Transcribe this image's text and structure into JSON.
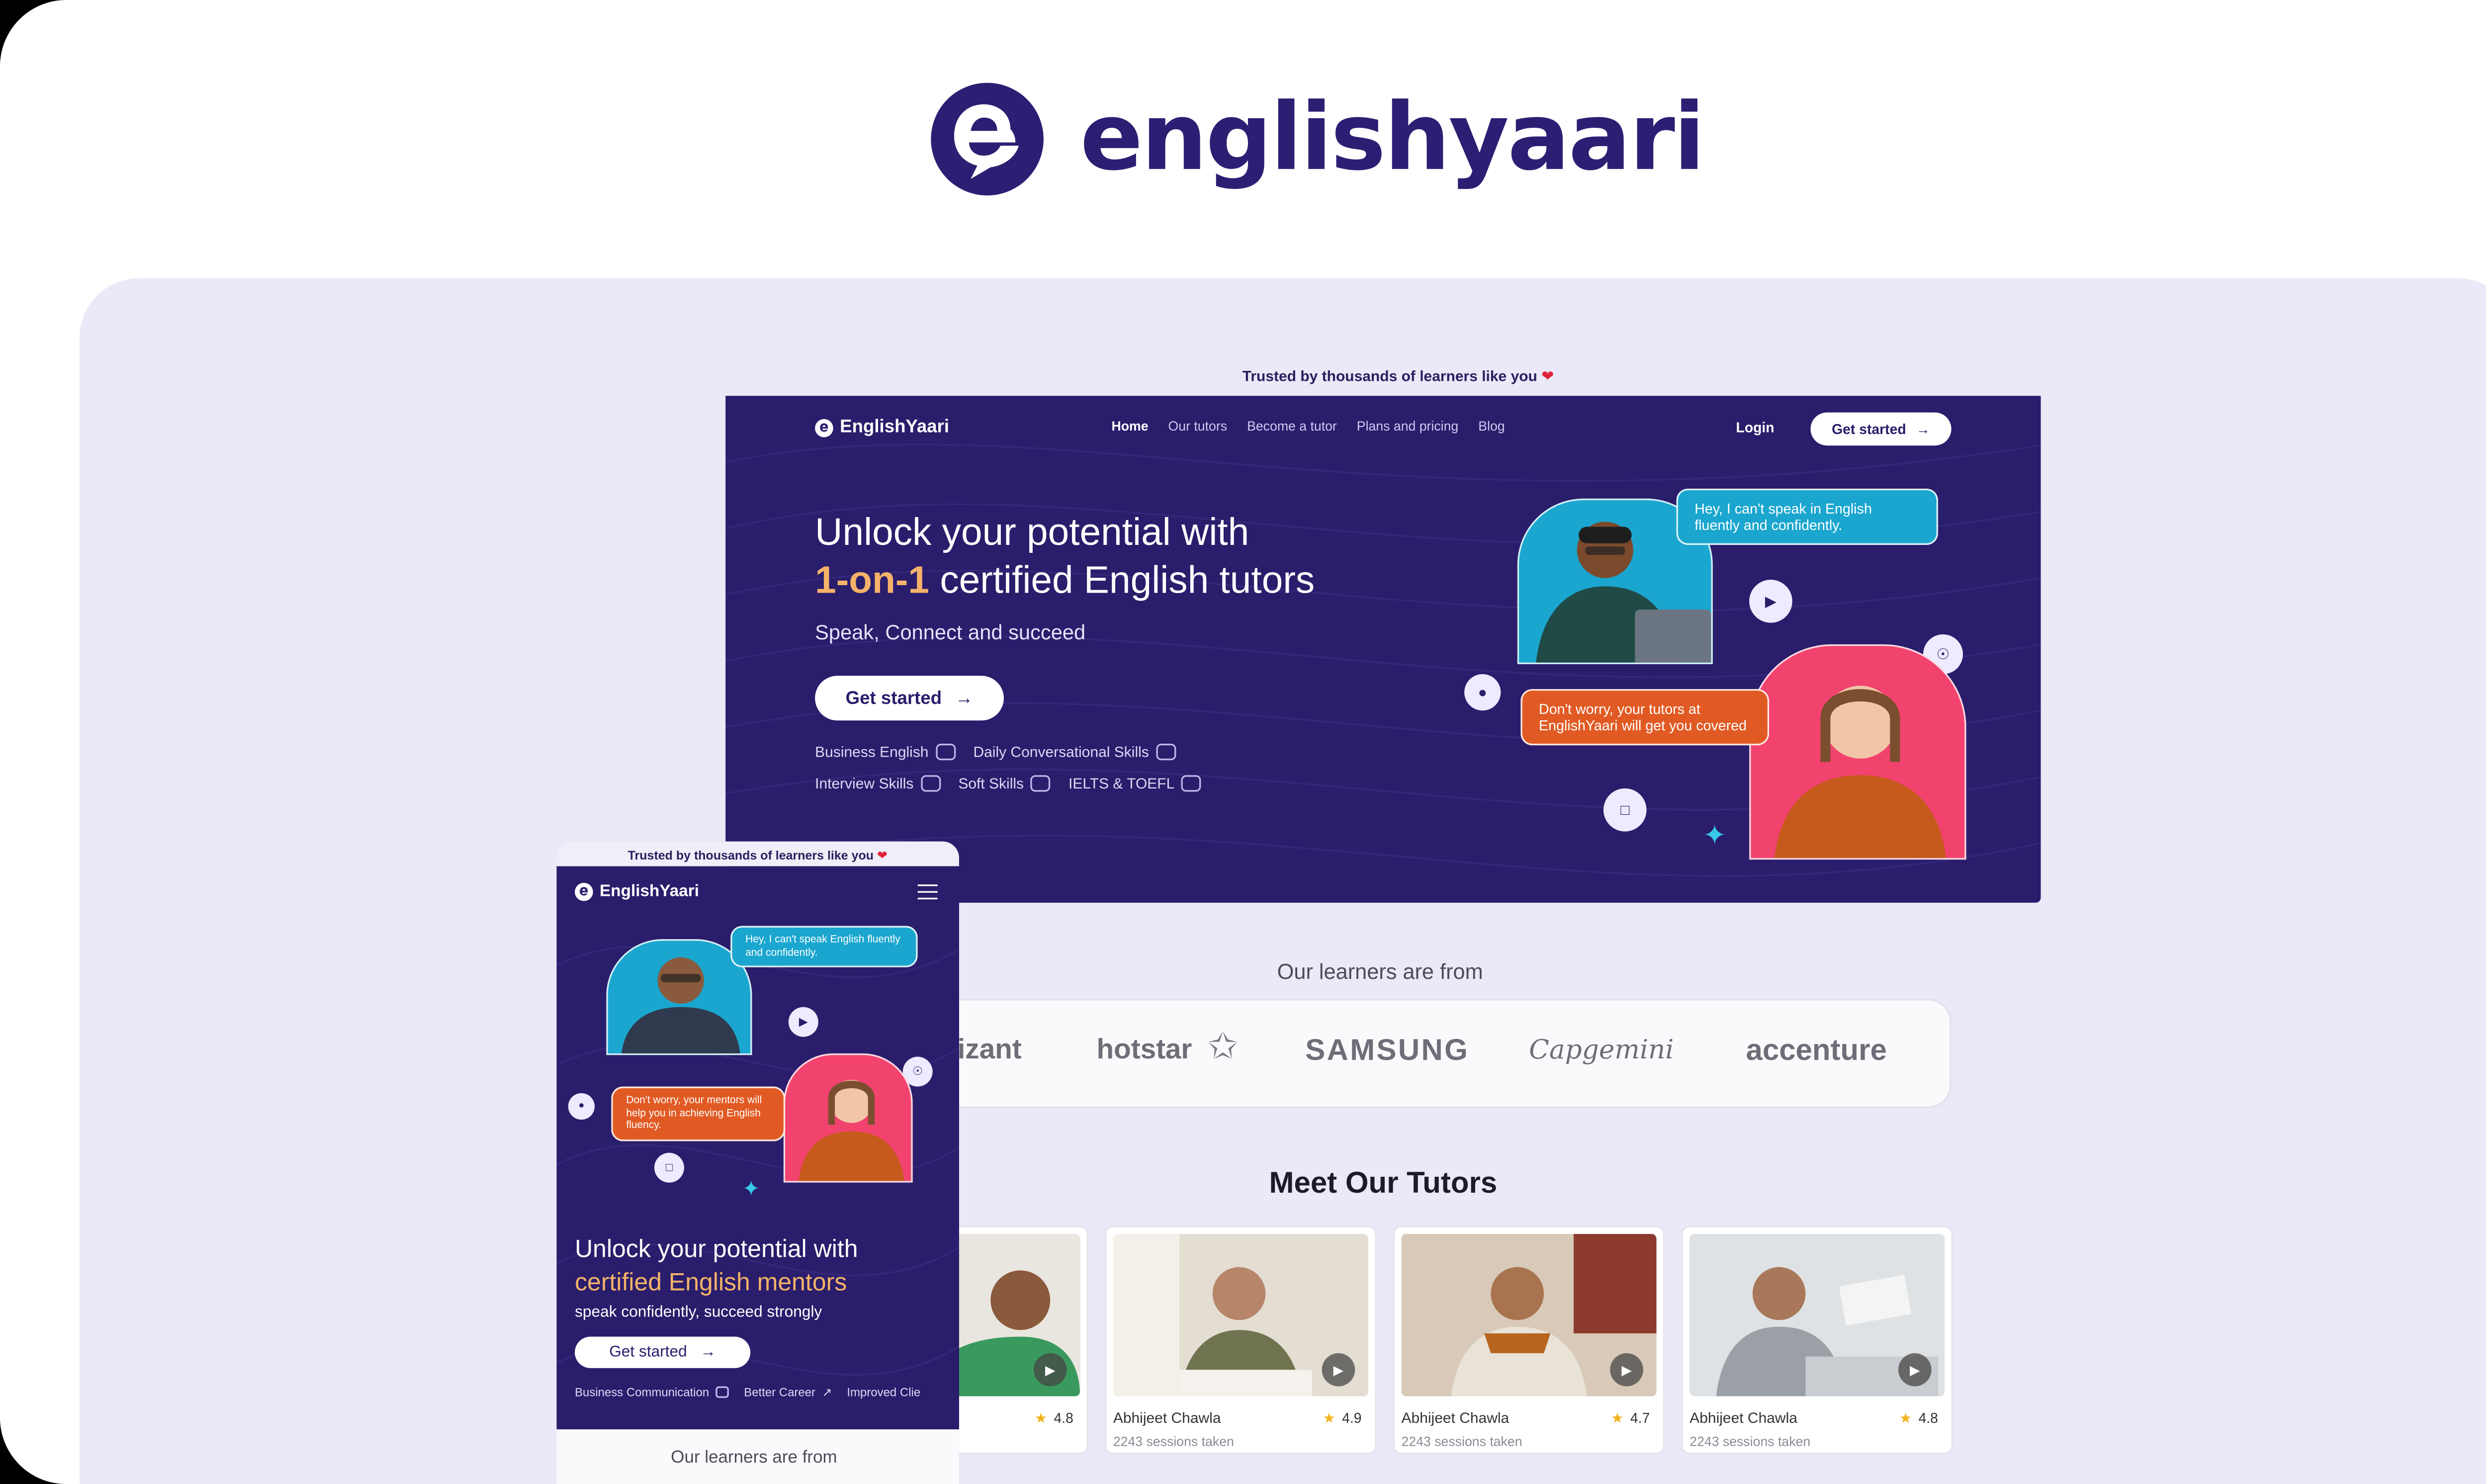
{
  "brand": {
    "name": "englishyaari",
    "colors": {
      "primary": "#2b1f73",
      "accent": "#f5b36a",
      "bubble_blue": "#1aa6cf",
      "bubble_orange": "#e15a23",
      "panel": "#ebe8f7"
    }
  },
  "desktop": {
    "trusted_text": "Trusted by thousands of learners like you",
    "trusted_icon": "heart-icon",
    "nav": {
      "logo_text": "EnglishYaari",
      "links": [
        "Home",
        "Our tutors",
        "Become a tutor",
        "Plans and pricing",
        "Blog"
      ],
      "login": "Login",
      "cta": "Get started"
    },
    "hero": {
      "title_line1": "Unlock your potential with",
      "title_highlight": "1-on-1",
      "title_line2": "certified English tutors",
      "subtitle": "Speak, Connect and succeed",
      "cta": "Get started",
      "tags": [
        {
          "label": "Business English",
          "icon": "handshake-icon"
        },
        {
          "label": "Daily Conversational Skills",
          "icon": "chat-icon"
        },
        {
          "label": "Interview Skills",
          "icon": "people-icon"
        },
        {
          "label": "Soft Skills",
          "icon": "user-circle-icon"
        },
        {
          "label": "IELTS & TOEFL",
          "icon": "document-icon"
        }
      ],
      "bubble_learner": "Hey, I can't speak in English fluently and confidently.",
      "bubble_tutor": "Don't worry, your tutors at EnglishYaari will get you covered"
    },
    "learners_title": "Our learners are from",
    "companies": [
      "izant",
      "hotstar",
      "SAMSUNG",
      "Capgemini",
      "accenture"
    ],
    "tutors_title": "Meet Our Tutors",
    "tutors": [
      {
        "name": "",
        "rating": "",
        "sessions": ""
      },
      {
        "name": "Abhijeet Chawla",
        "rating": "4.9",
        "sessions": "2243 sessions taken"
      },
      {
        "name": "Abhijeet Chawla",
        "rating": "4.7",
        "sessions": "2243 sessions taken"
      },
      {
        "name": "Abhijeet Chawla",
        "rating": "4.8",
        "sessions": "2243 sessions taken"
      }
    ],
    "first_card_rating": "4.8"
  },
  "mobile": {
    "trusted_text": "Trusted by thousands of learners like you",
    "logo_text": "EnglishYaari",
    "bubble_learner": "Hey, I can't speak English fluently and confidently.",
    "bubble_tutor": "Don't worry, your mentors will help you in achieving English fluency.",
    "title_line1": "Unlock your potential with",
    "title_highlight": "certified English mentors",
    "subtitle": "speak confidently, succeed strongly",
    "cta": "Get started",
    "tags": [
      "Business Communication",
      "Better Career",
      "Improved Clie"
    ],
    "learners_title": "Our learners are from"
  }
}
